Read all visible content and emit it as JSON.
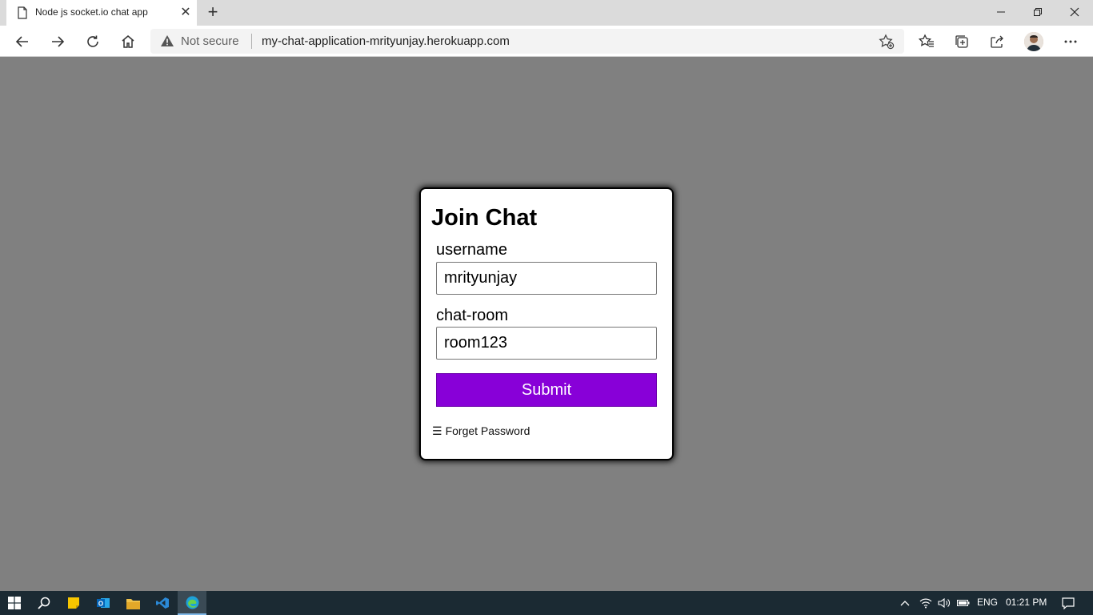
{
  "browser": {
    "tab_title": "Node js socket.io chat app",
    "close_tab_glyph": "✕",
    "new_tab_glyph": "+",
    "security_text": "Not secure",
    "url": "my-chat-application-mrityunjay.herokuapp.com",
    "icons": [
      "back-icon",
      "forward-icon",
      "refresh-icon",
      "home-icon",
      "favorites-add-icon",
      "favorites-icon",
      "collections-icon",
      "share-icon",
      "profile-avatar",
      "more-icon"
    ]
  },
  "form": {
    "heading": "Join Chat",
    "username_label": "username",
    "username_value": "mrityunjay",
    "room_label": "chat-room",
    "room_value": "room123",
    "submit_label": "Submit",
    "forget_glyph": "☰",
    "forget_label": "Forget Password",
    "submit_color": "#8800d8"
  },
  "taskbar": {
    "language": "ENG",
    "time": "01:21 PM"
  },
  "colors": {
    "page_background": "#808080",
    "taskbar": "#1b2a33"
  }
}
